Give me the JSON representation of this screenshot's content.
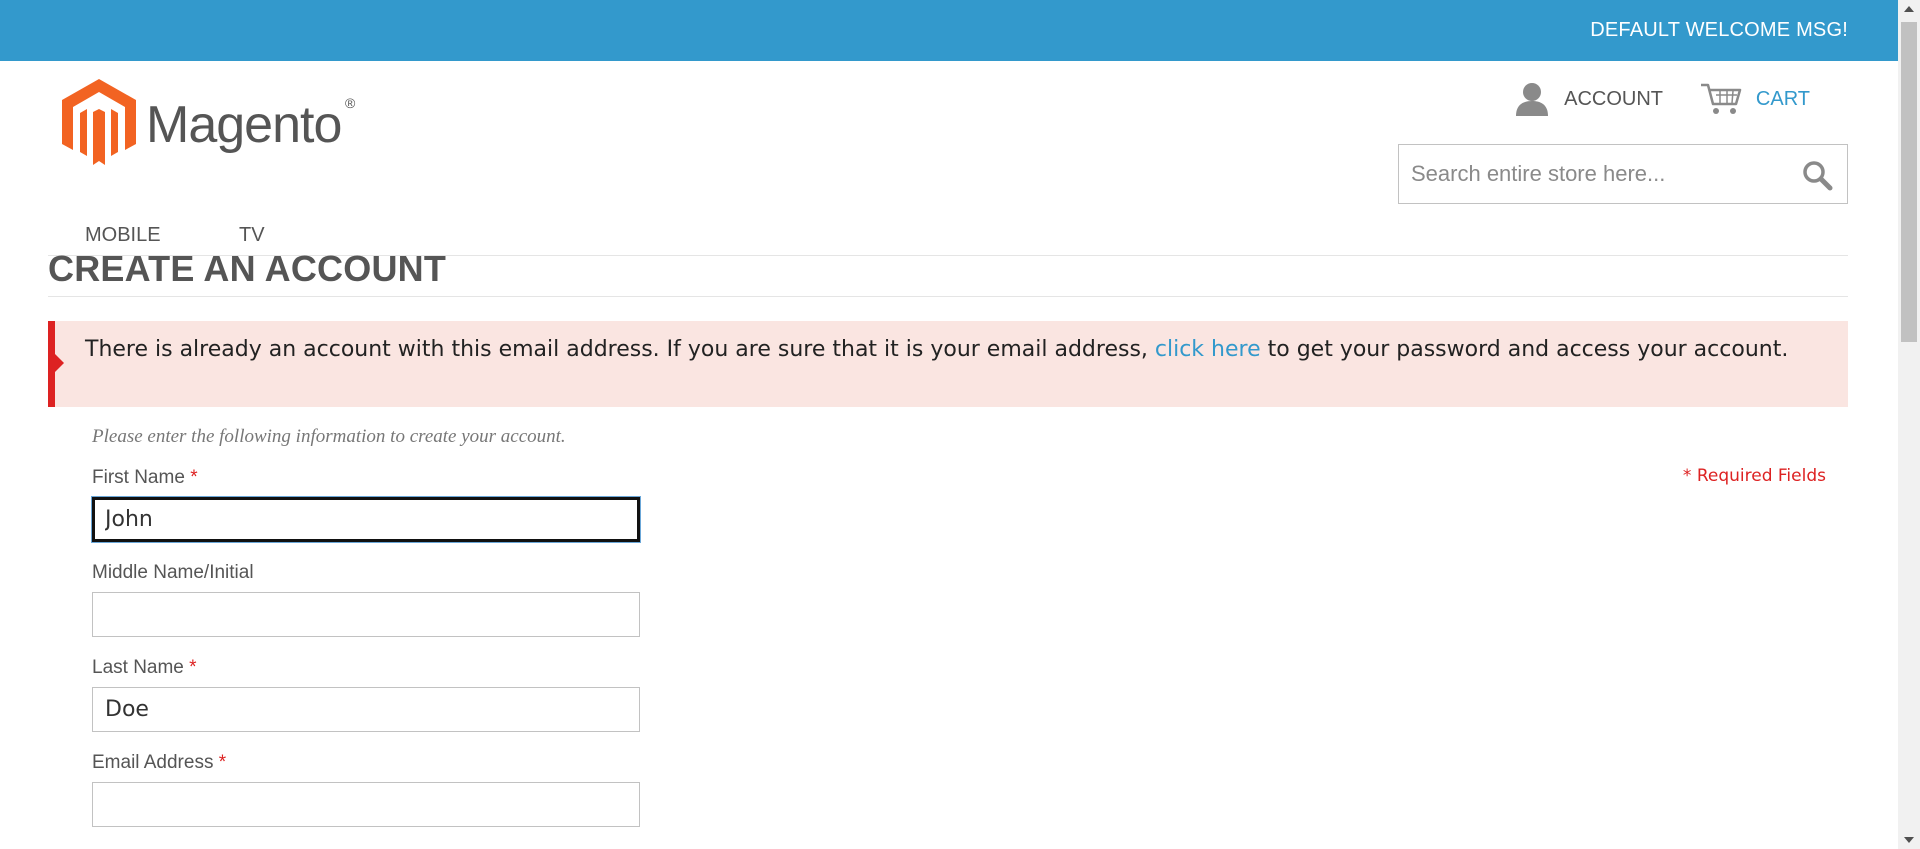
{
  "topbar": {
    "welcome": "DEFAULT WELCOME MSG!"
  },
  "header": {
    "logo": {
      "text": "Magento",
      "mark": "®"
    },
    "account_label": "ACCOUNT",
    "cart_label": "CART",
    "search": {
      "placeholder": "Search entire store here...",
      "value": ""
    }
  },
  "nav": {
    "items": [
      {
        "label": "MOBILE"
      },
      {
        "label": "TV"
      }
    ]
  },
  "page": {
    "title": "CREATE AN ACCOUNT",
    "error": {
      "text_before": "There is already an account with this email address. If you are sure that it is your email address, ",
      "link": "click here",
      "text_after": " to get your password and access your account."
    },
    "intro": "Please enter the following information to create your account.",
    "required_note": "* Required Fields"
  },
  "form": {
    "first_name": {
      "label": "First Name",
      "required_mark": "*",
      "value": "John"
    },
    "middle_name": {
      "label": "Middle Name/Initial",
      "value": ""
    },
    "last_name": {
      "label": "Last Name",
      "required_mark": "*",
      "value": "Doe"
    },
    "email": {
      "label": "Email Address",
      "required_mark": "*",
      "value": ""
    }
  },
  "icons": {
    "account": "user-icon",
    "cart": "cart-icon",
    "search": "search-icon",
    "error_marker": "error-arrow-icon"
  },
  "colors": {
    "topbar": "#3399cc",
    "link": "#3399cc",
    "error_bg": "#fae5e1",
    "error_accent": "#dd2222",
    "logo_orange": "#f26322"
  }
}
